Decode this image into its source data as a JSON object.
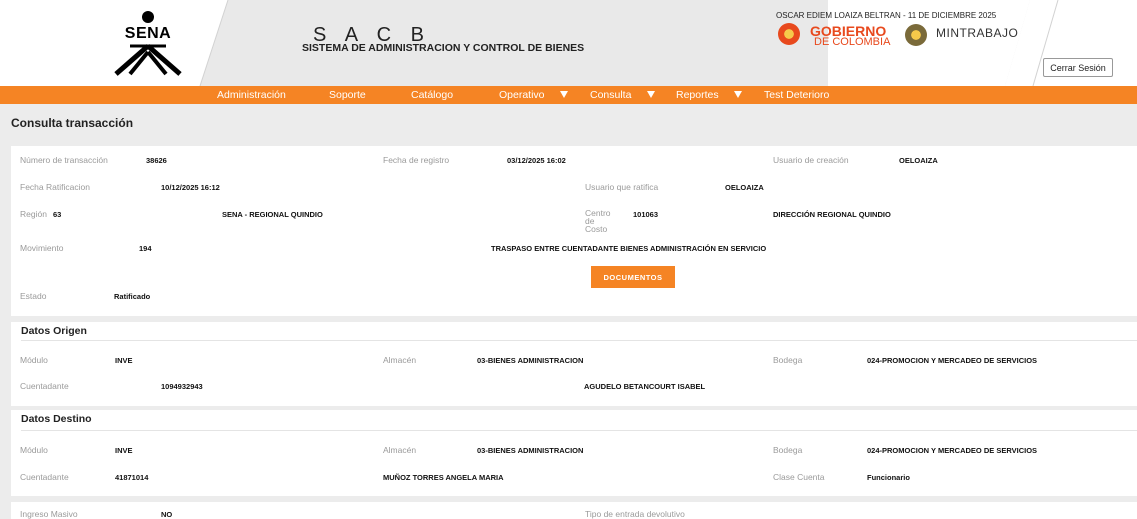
{
  "header": {
    "brand_logo": "SENA",
    "app_acronym": "S A C B",
    "app_subtitle": "SISTEMA DE ADMINISTRACION Y CONTROL DE BIENES",
    "user_line": "OSCAR EDIEM LOAIZA BELTRAN - 11 DE DICIEMBRE 2025",
    "gobierno_line1": "GOBIERNO",
    "gobierno_line2": "DE COLOMBIA",
    "mintrabajo": "MINTRABAJO",
    "logout_label": "Cerrar Sesión",
    "colors": {
      "brand_orange": "#f58424",
      "gob_orange": "#e8491d"
    }
  },
  "nav": {
    "items": [
      "Administración",
      "Soporte",
      "Catálogo",
      "Operativo",
      "Consulta",
      "Reportes",
      "Test Deterioro"
    ],
    "dropdown_icon": "caret-down-icon"
  },
  "page": {
    "title": "Consulta transacción"
  },
  "transaction": {
    "numero_label": "Número de transacción",
    "numero_value": "38626",
    "fecha_registro_label": "Fecha de registro",
    "fecha_registro_value": "03/12/2025 16:02",
    "usuario_creacion_label": "Usuario de creación",
    "usuario_creacion_value": "OELOAIZA",
    "fecha_ratificacion_label": "Fecha Ratificacion",
    "fecha_ratificacion_value": "10/12/2025 16:12",
    "usuario_ratifica_label": "Usuario que ratifica",
    "usuario_ratifica_value": "OELOAIZA",
    "region_label": "Región",
    "region_code": "63",
    "region_name": "SENA - REGIONAL QUINDIO",
    "centro_costo_label_1": "Centro",
    "centro_costo_label_2": "de",
    "centro_costo_label_3": "Costo",
    "centro_costo_code": "101063",
    "centro_costo_name": "DIRECCIÓN REGIONAL QUINDIO",
    "movimiento_label": "Movimiento",
    "movimiento_code": "194",
    "movimiento_desc": "TRASPASO ENTRE CUENTADANTE BIENES ADMINISTRACIÓN EN SERVICIO",
    "documentos_label": "DOCUMENTOS",
    "estado_label": "Estado",
    "estado_value": "Ratificado"
  },
  "origen": {
    "title": "Datos Origen",
    "modulo_label": "Módulo",
    "modulo_value": "INVE",
    "almacen_label": "Almacén",
    "almacen_value": "03-BIENES ADMINISTRACION",
    "bodega_label": "Bodega",
    "bodega_value": "024-PROMOCION Y MERCADEO DE SERVICIOS",
    "cuentadante_label": "Cuentadante",
    "cuentadante_id": "1094932943",
    "cuentadante_name": "AGUDELO BETANCOURT ISABEL"
  },
  "destino": {
    "title": "Datos Destino",
    "modulo_label": "Módulo",
    "modulo_value": "INVE",
    "almacen_label": "Almacén",
    "almacen_value": "03-BIENES ADMINISTRACION",
    "bodega_label": "Bodega",
    "bodega_value": "024-PROMOCION Y MERCADEO DE SERVICIOS",
    "cuentadante_label": "Cuentadante",
    "cuentadante_id": "41871014",
    "cuentadante_name": "MUÑOZ TORRES ANGELA MARIA",
    "clase_cuenta_label": "Clase Cuenta",
    "clase_cuenta_value": "Funcionario"
  },
  "extra": {
    "ingreso_masivo_label": "Ingreso Masivo",
    "ingreso_masivo_value": "NO",
    "tipo_entrada_label": "Tipo de entrada devolutivo"
  }
}
